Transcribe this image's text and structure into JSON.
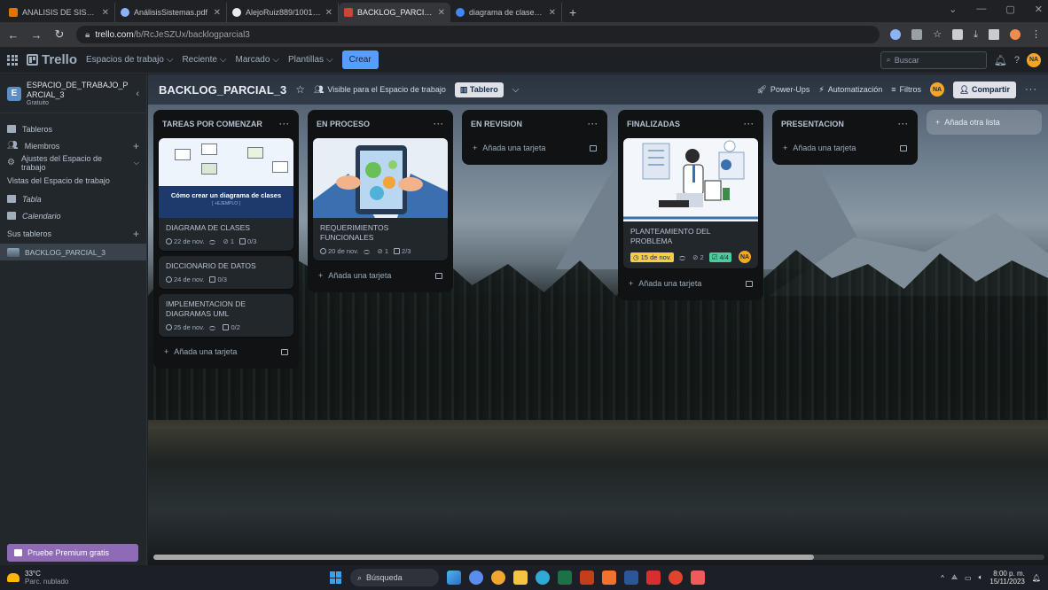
{
  "browser": {
    "tabs": [
      {
        "label": "ANALISIS DE SISTEMAS [G1]-82",
        "color": "#e37400",
        "active": false
      },
      {
        "label": "AnálisisSistemas.pdf",
        "color": "#8ab4f8",
        "active": false
      },
      {
        "label": "AlejoRuiz889/1001349158_parc",
        "color": "#e8eaed",
        "active": false
      },
      {
        "label": "BACKLOG_PARCIAL_3 | Trello",
        "color": "#d04437",
        "active": true
      },
      {
        "label": "diagrama de clases - Búsqueda",
        "color": "#4285f4",
        "active": false
      }
    ],
    "new_tab": "+",
    "url_domain": "trello.com",
    "url_path": "/b/RcJeSZUx/backlogparcial3"
  },
  "header": {
    "logo": "Trello",
    "menus": [
      "Espacios de trabajo",
      "Reciente",
      "Marcado",
      "Plantillas"
    ],
    "create": "Crear",
    "search_placeholder": "Buscar",
    "avatar": "NA"
  },
  "sidebar": {
    "workspace_initial": "E",
    "workspace_name_line1": "ESPACIO_DE_TRABAJO_P",
    "workspace_name_line2": "ARCIAL_3",
    "plan": "Gratuito",
    "items": [
      "Tableros",
      "Miembros",
      "Ajustes del Espacio de trabajo"
    ],
    "views_title": "Vistas del Espacio de trabajo",
    "views": [
      "Tabla",
      "Calendario"
    ],
    "boards_title": "Sus tableros",
    "boards": [
      "BACKLOG_PARCIAL_3"
    ],
    "premium": "Pruebe Premium gratis"
  },
  "board": {
    "title": "BACKLOG_PARCIAL_3",
    "visibility": "Visible para el Espacio de trabajo",
    "view": "Tablero",
    "powerups": "Power-Ups",
    "automation": "Automatización",
    "filters": "Filtros",
    "member": "NA",
    "share": "Compartir",
    "add_list": "Añada otra lista",
    "add_card": "Añada una tarjeta"
  },
  "lists": [
    {
      "title": "TAREAS POR COMENZAR",
      "cards": [
        {
          "title": "DIAGRAMA DE CLASES",
          "due": "22 de nov.",
          "attachments": "1",
          "checklist": "0/3",
          "cover_title": "Cómo crear un diagrama de clases",
          "cover_sub": "[ +EJEMPLO ]"
        },
        {
          "title": "DICCIONARIO DE DATOS",
          "due": "24 de nov.",
          "checklist": "0/3"
        },
        {
          "title": "IMPLEMENTACION DE DIAGRAMAS UML",
          "due": "25 de nov.",
          "checklist": "0/2"
        }
      ]
    },
    {
      "title": "EN PROCESO",
      "cards": [
        {
          "title": "REQUERIMIENTOS FUNCIONALES",
          "due": "20 de nov.",
          "attachments": "1",
          "checklist": "2/3"
        }
      ]
    },
    {
      "title": "EN REVISION",
      "cards": []
    },
    {
      "title": "FINALIZADAS",
      "cards": [
        {
          "title": "PLANTEAMIENTO DEL PROBLEMA",
          "due": "15 de nov.",
          "attachments": "2",
          "checklist": "4/4",
          "member": "NA"
        }
      ]
    },
    {
      "title": "PRESENTACION",
      "cards": []
    }
  ],
  "taskbar": {
    "temp": "33°C",
    "weather": "Parc. nublado",
    "search": "Búsqueda",
    "time": "8:00 p. m.",
    "date": "15/11/2023"
  },
  "colors": {
    "accent": "#579dff",
    "premium": "#8f6bb6",
    "due_soon": "#f5cd47",
    "complete": "#4bce97"
  }
}
